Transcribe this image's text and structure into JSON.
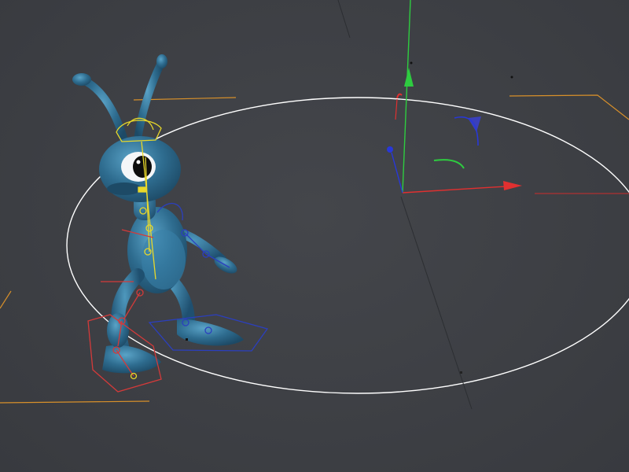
{
  "viewport": {
    "background": "#3d3f44",
    "mode": "3d-perspective"
  },
  "scene": {
    "ground_circle": {
      "color": "#ffffff"
    },
    "safe_frame": {
      "color": "#d8902a"
    },
    "character": {
      "body_color": "#2e6c8f",
      "highlight_color": "#5aa3c7",
      "rig_color_head": "#e8d82a",
      "rig_color_left": "#d33a3a",
      "rig_color_right": "#2b3fbf"
    },
    "manipulator": {
      "x_axis_color": "#e03030",
      "y_axis_color": "#2ecc40",
      "z_axis_color": "#2838d8",
      "selected": "move-gizmo"
    }
  }
}
